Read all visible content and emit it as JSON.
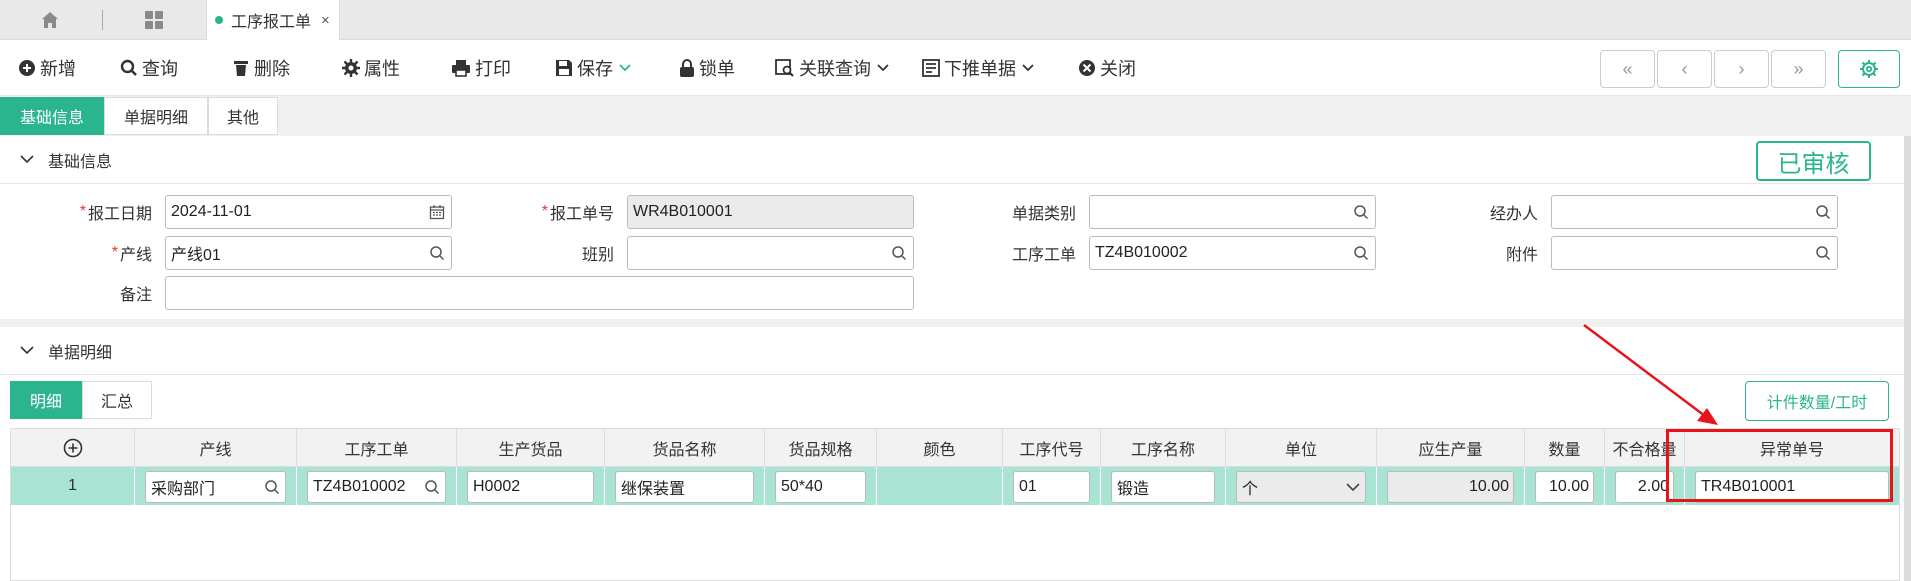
{
  "tabs": {
    "doc_tab": "工序报工单",
    "close": "×"
  },
  "toolbar": {
    "add": "新增",
    "query": "查询",
    "delete": "删除",
    "properties": "属性",
    "print": "打印",
    "save": "保存",
    "lock": "锁单",
    "related_query": "关联查询",
    "push_down": "下推单据",
    "close": "关闭",
    "nav_first": "«",
    "nav_prev": "‹",
    "nav_next": "›",
    "nav_last": "»"
  },
  "subtabs": [
    "基础信息",
    "单据明细",
    "其他"
  ],
  "basic": {
    "section_title": "基础信息",
    "status": "已审核",
    "report_date_label": "报工日期",
    "report_date": "2024-11-01",
    "report_no_label": "报工单号",
    "report_no": "WR4B010001",
    "doc_type_label": "单据类别",
    "doc_type": "",
    "handler_label": "经办人",
    "handler": "",
    "line_label": "产线",
    "line": "产线01",
    "shift_label": "班别",
    "shift": "",
    "work_order_label": "工序工单",
    "work_order": "TZ4B010002",
    "attachment_label": "附件",
    "attachment": "",
    "remark_label": "备注",
    "remark": ""
  },
  "detail": {
    "section_title": "单据明细",
    "tabs": [
      "明细",
      "汇总"
    ],
    "calc_button": "计件数量/工时",
    "columns": [
      "产线",
      "工序工单",
      "生产货品",
      "货品名称",
      "货品规格",
      "颜色",
      "工序代号",
      "工序名称",
      "单位",
      "应生产量",
      "数量",
      "不合格量",
      "异常单号"
    ],
    "row": {
      "index": "1",
      "line": "采购部门",
      "work_order": "TZ4B010002",
      "product": "H0002",
      "product_name": "继保装置",
      "spec": "50*40",
      "color": "",
      "process_code": "01",
      "process_name": "锻造",
      "unit": "个",
      "planned_qty": "10.00",
      "qty": "10.00",
      "defect_qty": "2.00",
      "exception_no": "TR4B010001"
    }
  },
  "colors": {
    "accent": "#2bb58f",
    "highlight": "#e8141c",
    "row_bg": "#a8e3d3"
  }
}
